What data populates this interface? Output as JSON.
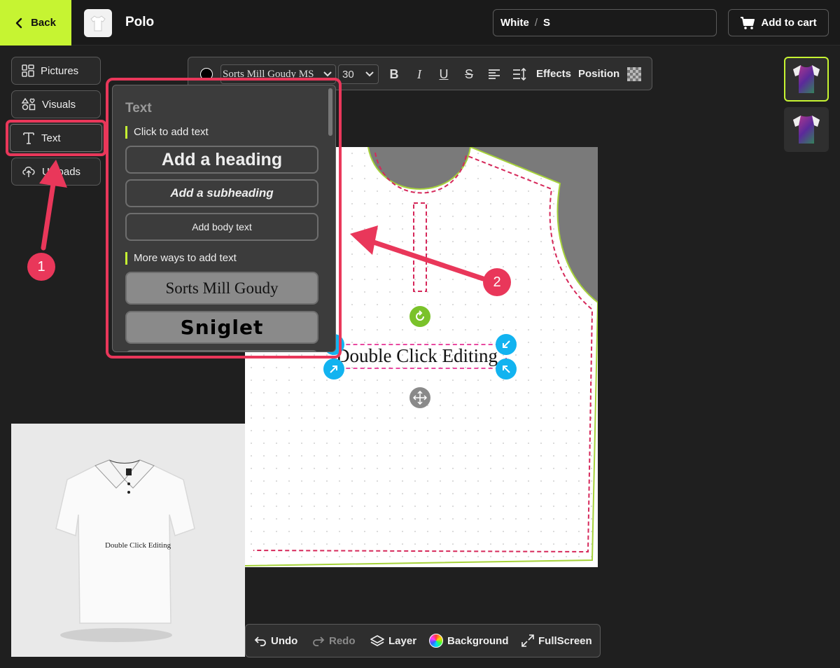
{
  "header": {
    "back_label": "Back",
    "product_name": "Polo",
    "variant_color": "White",
    "variant_separator": "/",
    "variant_size": "S",
    "cart_label": "Add to cart"
  },
  "sidebar": {
    "items": [
      {
        "label": "Pictures",
        "icon": "grid-icon"
      },
      {
        "label": "Visuals",
        "icon": "shapes-icon"
      },
      {
        "label": "Text",
        "icon": "text-icon"
      },
      {
        "label": "Uploads",
        "icon": "cloud-upload-icon"
      }
    ]
  },
  "toolbar": {
    "font_value": "Sorts Mill Goudy MS",
    "size_value": "30",
    "effects_label": "Effects",
    "position_label": "Position",
    "color": "#000000"
  },
  "text_panel": {
    "title": "Text",
    "click_section": "Click to add text",
    "heading_btn": "Add a heading",
    "subheading_btn": "Add a subheading",
    "body_btn": "Add body text",
    "more_section": "More ways to add text",
    "font_samples": [
      "Sorts Mill Goudy",
      "Sniglet"
    ]
  },
  "canvas": {
    "text": "Double Click Editing"
  },
  "preview": {
    "text": "Double Click Editing"
  },
  "bottombar": {
    "undo": "Undo",
    "redo": "Redo",
    "layer": "Layer",
    "background": "Background",
    "fullscreen": "FullScreen"
  },
  "annotations": {
    "badge_1": "1",
    "badge_2": "2",
    "color": "#e9375a"
  },
  "colors": {
    "accent": "#c6f432",
    "handle": "#12b3f0"
  }
}
